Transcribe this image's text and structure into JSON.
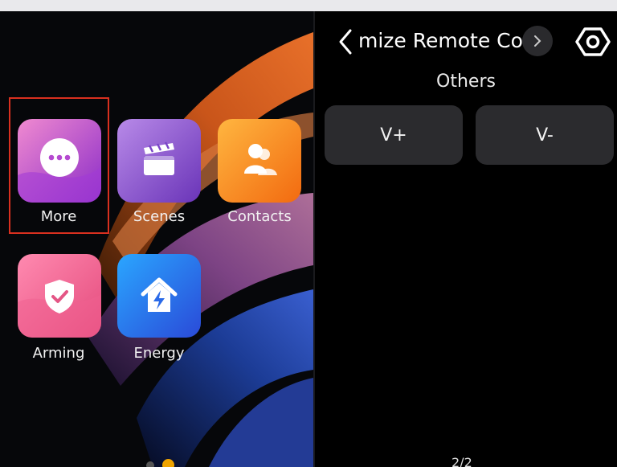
{
  "home": {
    "apps": [
      {
        "label": "More",
        "icon": "more-icon"
      },
      {
        "label": "Scenes",
        "icon": "clapperboard-icon"
      },
      {
        "label": "Contacts",
        "icon": "contacts-icon"
      },
      {
        "label": "Arming",
        "icon": "shield-check-icon"
      },
      {
        "label": "Energy",
        "icon": "house-bolt-icon"
      }
    ],
    "page_dots": {
      "count": 2,
      "active": 2
    }
  },
  "remote": {
    "title": "mize Remote Co",
    "section": "Others",
    "buttons": [
      "V+",
      "V-"
    ],
    "page_indicator": "2/2"
  },
  "colors": {
    "selection": "#d9301f",
    "button_bg": "#2b2b2e",
    "dot_active": "#f0a400"
  }
}
